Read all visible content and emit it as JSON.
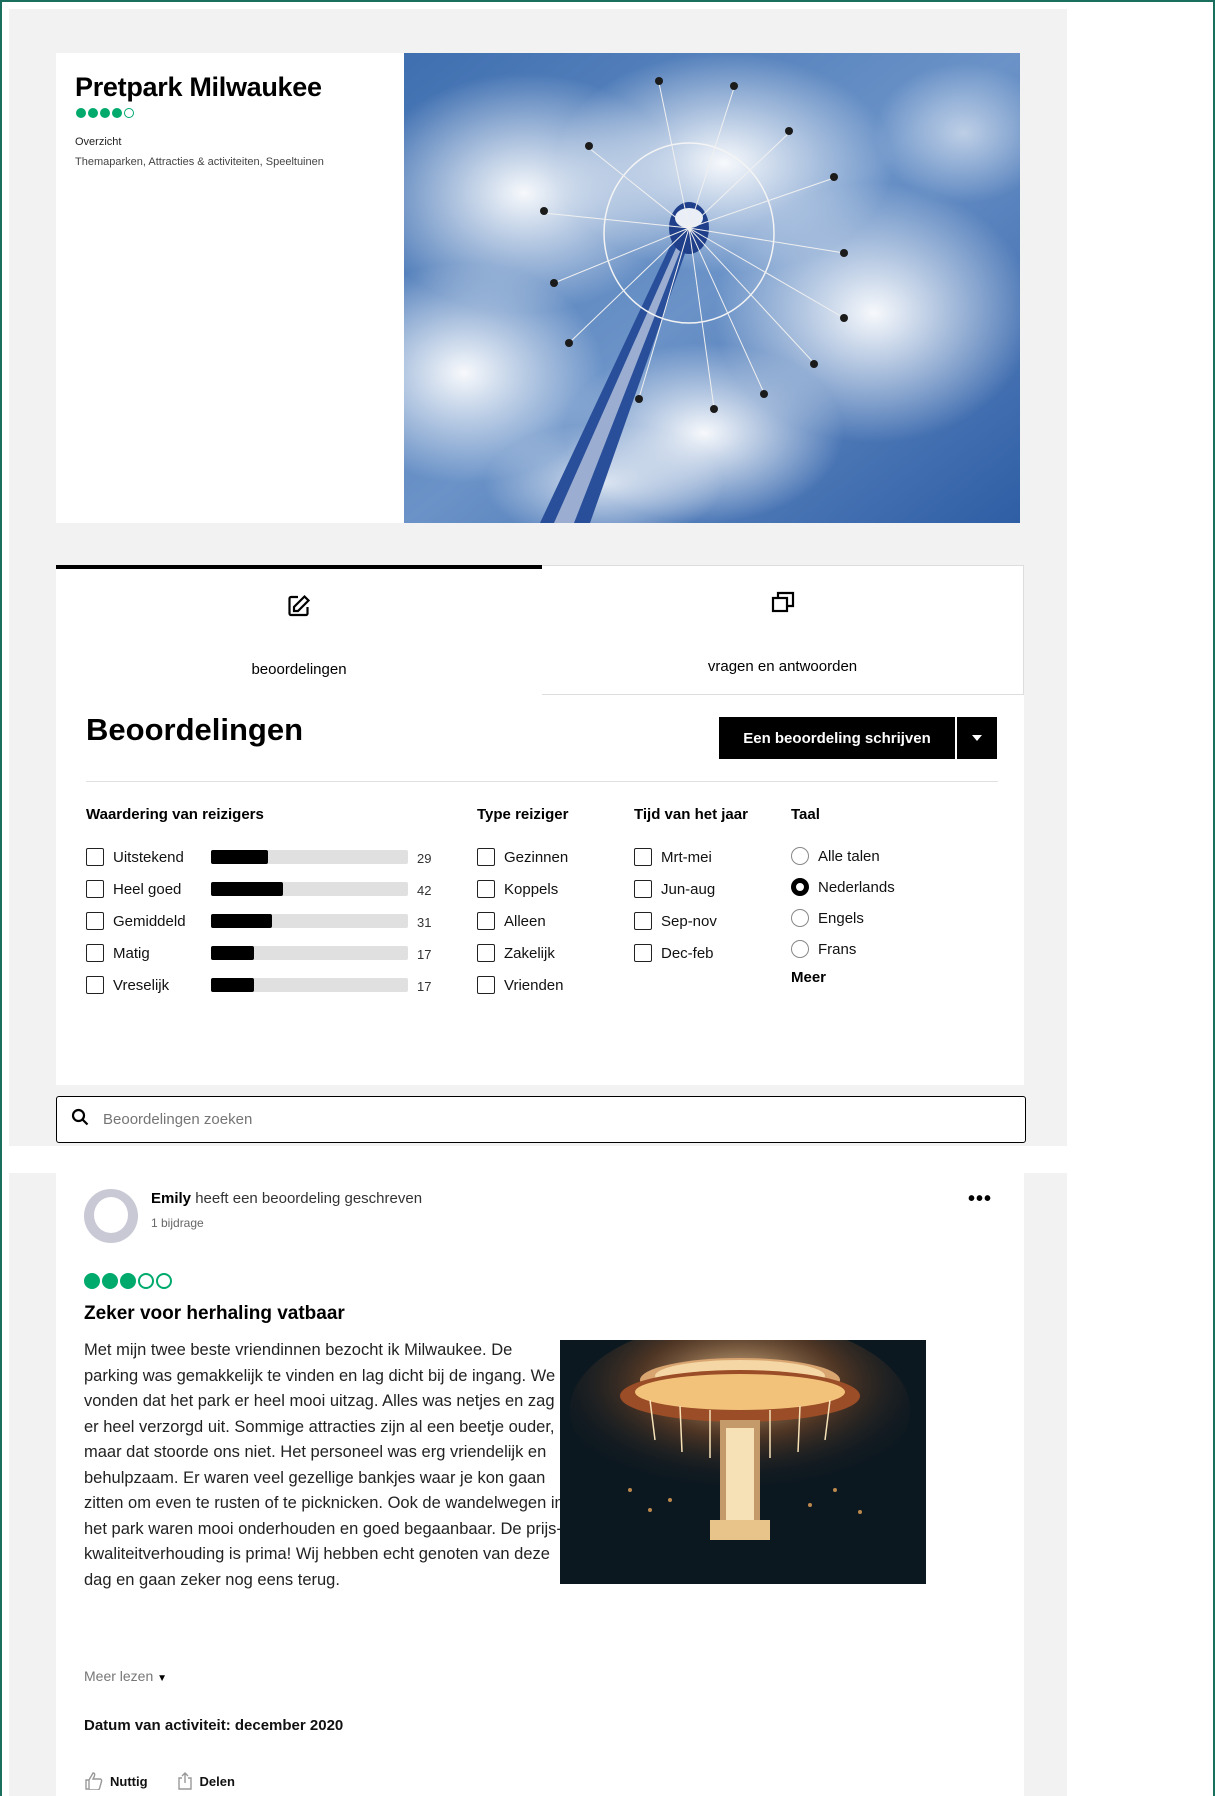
{
  "header": {
    "title": "Pretpark Milwaukee",
    "rating": 4,
    "overview_label": "Overzicht",
    "categories": "Themaparken, Attracties & activiteiten, Speeltuinen"
  },
  "tabs": [
    {
      "label": "beoordelingen",
      "icon": "pencil-edit-icon",
      "active": true
    },
    {
      "label": "vragen en antwoorden",
      "icon": "chat-bubbles-icon",
      "active": false
    }
  ],
  "reviews_section": {
    "title": "Beoordelingen",
    "write_button": "Een beoordeling schrijven",
    "dropdown_icon": "caret-down-icon"
  },
  "filters": {
    "rating_header": "Waardering van reizigers",
    "ratings": [
      {
        "label": "Uitstekend",
        "count": "29",
        "fraction": 0.29
      },
      {
        "label": "Heel goed",
        "count": "42",
        "fraction": 0.36
      },
      {
        "label": "Gemiddeld",
        "count": "31",
        "fraction": 0.31
      },
      {
        "label": "Matig",
        "count": "17",
        "fraction": 0.22
      },
      {
        "label": "Vreselijk",
        "count": "17",
        "fraction": 0.22
      }
    ],
    "type_header": "Type reiziger",
    "types": [
      "Gezinnen",
      "Koppels",
      "Alleen",
      "Zakelijk",
      "Vrienden"
    ],
    "time_header": "Tijd van het jaar",
    "times": [
      "Mrt-mei",
      "Jun-aug",
      "Sep-nov",
      "Dec-feb"
    ],
    "lang_header": "Taal",
    "languages": [
      {
        "label": "Alle talen",
        "selected": false
      },
      {
        "label": "Nederlands",
        "selected": true
      },
      {
        "label": "Engels",
        "selected": false
      },
      {
        "label": "Frans",
        "selected": false
      }
    ],
    "more_label": "Meer"
  },
  "search": {
    "placeholder": "Beoordelingen zoeken",
    "icon": "search-icon"
  },
  "review": {
    "author": "Emily",
    "author_suffix": "heeft een beoordeling geschreven",
    "contributions": "1 bijdrage",
    "rating": 3,
    "title": "Zeker voor herhaling vatbaar",
    "text": "Met mijn twee beste vriendinnen bezocht ik Milwaukee. De parking was gemakkelijk te vinden en lag dicht bij de ingang. We vonden dat het park er heel mooi uitzag. Alles was netjes en zag er heel verzorgd uit. Sommige attracties zijn al een beetje ouder, maar dat stoorde ons niet. Het personeel was erg vriendelijk en behulpzaam. Er waren veel gezellige bankjes waar je kon gaan zitten om even te rusten of te picknicken. Ook de wandelwegen in het park waren mooi onderhouden en goed begaanbaar. De prijs-kwaliteitverhouding is prima! Wij hebben echt genoten van deze dag en gaan zeker nog eens terug.",
    "read_more": "Meer lezen",
    "date_label": "Datum van activiteit: december 2020",
    "helpful_label": "Nuttig",
    "share_label": "Delen"
  },
  "colors": {
    "accent_green": "#00aa6c",
    "frame_teal": "#1a6e5e"
  }
}
